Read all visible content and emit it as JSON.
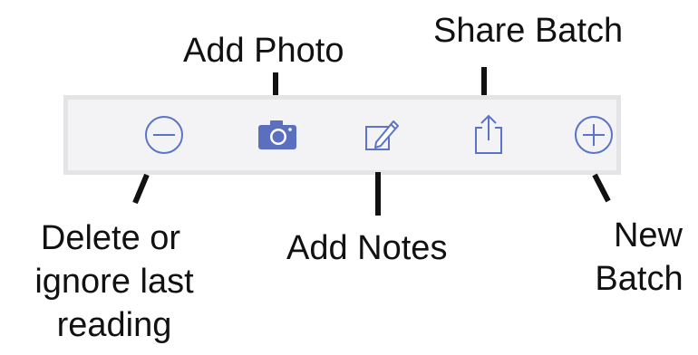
{
  "toolbar": {
    "buttons": [
      {
        "id": "delete",
        "icon": "minus-circle-icon"
      },
      {
        "id": "add-photo",
        "icon": "camera-icon"
      },
      {
        "id": "add-notes",
        "icon": "compose-icon"
      },
      {
        "id": "share-batch",
        "icon": "share-icon"
      },
      {
        "id": "new-batch",
        "icon": "plus-circle-icon"
      }
    ],
    "icon_color": "#5b74c9",
    "camera_color": "#5b6fbf"
  },
  "callouts": {
    "add_photo": "Add Photo",
    "share_batch": "Share Batch",
    "delete_line1": "Delete or",
    "delete_line2": "ignore last",
    "delete_line3": "reading",
    "add_notes": "Add Notes",
    "new_batch_line1": "New",
    "new_batch_line2": "Batch"
  }
}
